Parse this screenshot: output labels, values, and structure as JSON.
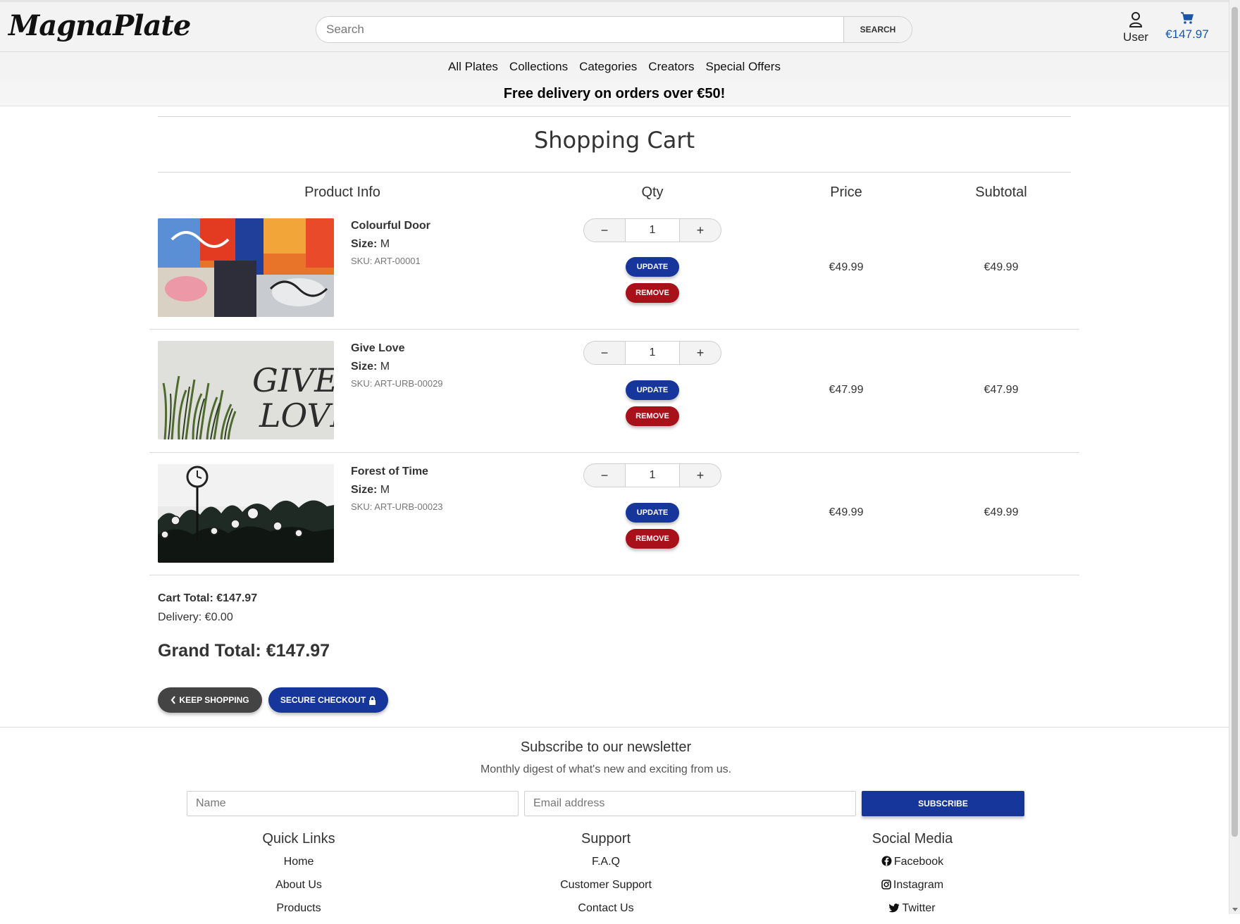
{
  "brand": {
    "logo_text": "MagnaPlate"
  },
  "search": {
    "placeholder": "Search",
    "value": "",
    "button_label": "SEARCH"
  },
  "header": {
    "user_label": "User",
    "cart_total": "€147.97",
    "accent_color": "#1a56a8"
  },
  "nav": {
    "items": [
      "All Plates",
      "Collections",
      "Categories",
      "Creators",
      "Special Offers"
    ]
  },
  "promo": {
    "text": "Free delivery on orders over €50!"
  },
  "cart": {
    "title": "Shopping Cart",
    "columns": {
      "product": "Product Info",
      "qty": "Qty",
      "price": "Price",
      "subtotal": "Subtotal"
    },
    "items": [
      {
        "name": "Colourful Door",
        "size_label": "Size:",
        "size": "M",
        "sku": "SKU: ART-00001",
        "qty": "1",
        "price": "€49.99",
        "subtotal": "€49.99",
        "image": "graffiti-wall"
      },
      {
        "name": "Give Love",
        "size_label": "Size:",
        "size": "M",
        "sku": "SKU: ART-URB-00029",
        "qty": "1",
        "price": "€47.99",
        "subtotal": "€47.99",
        "image": "give-love-wall"
      },
      {
        "name": "Forest of Time",
        "size_label": "Size:",
        "size": "M",
        "sku": "SKU: ART-URB-00023",
        "qty": "1",
        "price": "€49.99",
        "subtotal": "€49.99",
        "image": "clocks-forest"
      }
    ],
    "minus_symbol": "−",
    "plus_symbol": "+",
    "update_label": "UPDATE",
    "remove_label": "REMOVE",
    "cart_total": "Cart Total: €147.97",
    "delivery": "Delivery: €0.00",
    "grand_total": "Grand Total: €147.97",
    "keep_shopping_label": "KEEP SHOPPING",
    "checkout_label": "SECURE CHECKOUT",
    "colors": {
      "update": "#16369b",
      "remove": "#a8101a",
      "keep": "#444444"
    }
  },
  "newsletter": {
    "title": "Subscribe to our newsletter",
    "subtitle": "Monthly digest of what's new and exciting from us.",
    "name_placeholder": "Name",
    "email_placeholder": "Email address",
    "subscribe_label": "SUBSCRIBE"
  },
  "footer": {
    "quick_links": {
      "title": "Quick Links",
      "items": [
        "Home",
        "About Us",
        "Products"
      ]
    },
    "support": {
      "title": "Support",
      "items": [
        "F.A.Q",
        "Customer Support",
        "Contact Us"
      ]
    },
    "social": {
      "title": "Social Media",
      "items": [
        "Facebook",
        "Instagram",
        "Twitter"
      ]
    }
  }
}
